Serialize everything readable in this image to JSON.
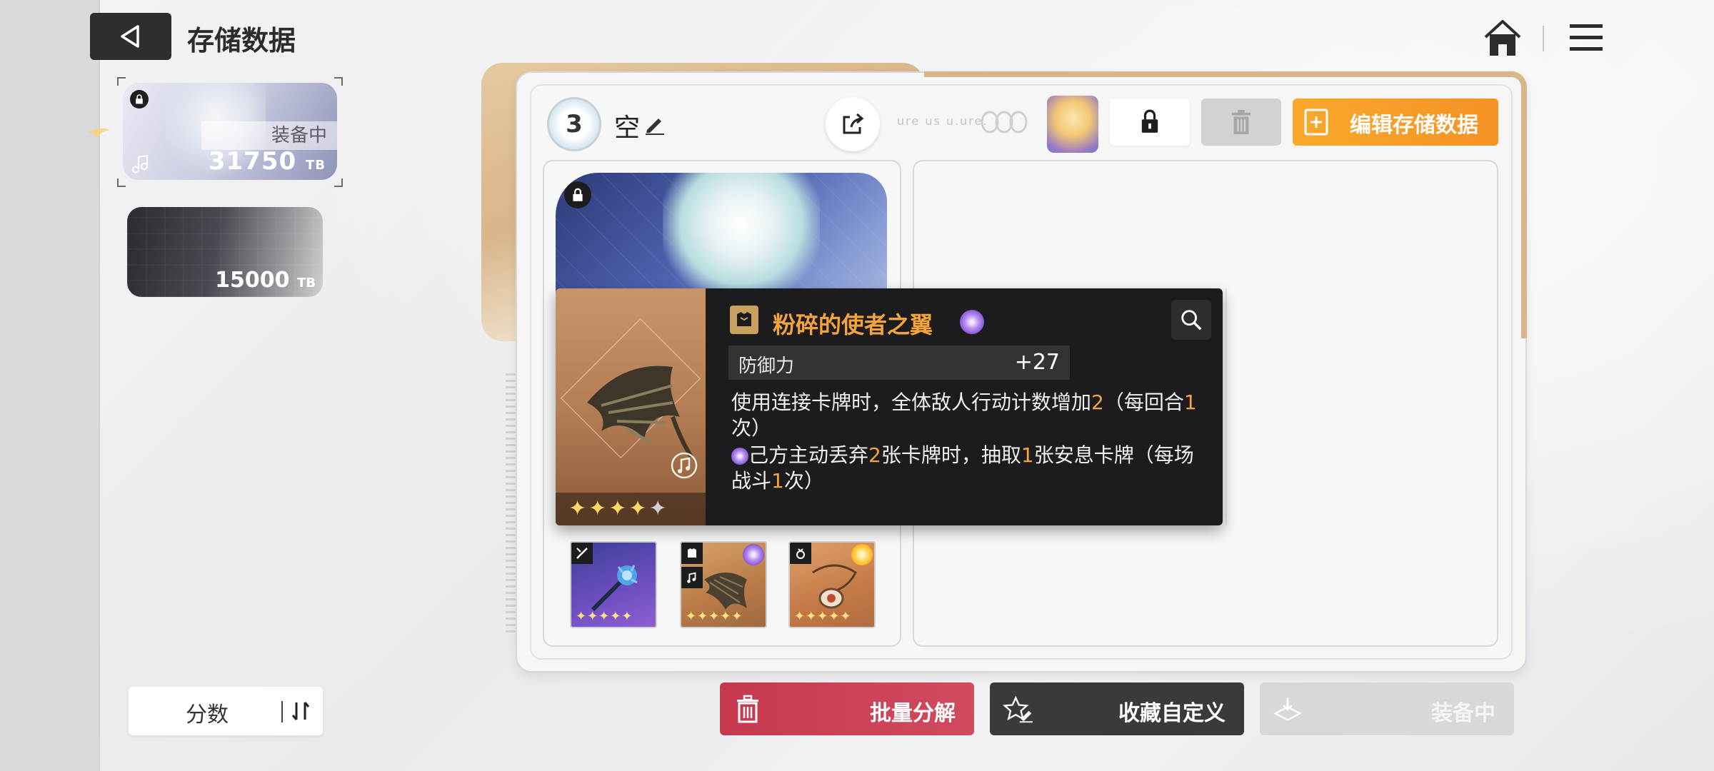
{
  "header": {
    "title": "存储数据"
  },
  "save_list": {
    "items": [
      {
        "status": "装备中",
        "score": "31750",
        "unit": "TB",
        "locked": true
      },
      {
        "status": "",
        "score": "15000",
        "unit": "TB",
        "locked": false
      }
    ]
  },
  "sort": {
    "label": "分数"
  },
  "panel": {
    "level": "3",
    "name": "空",
    "faded_code": "ure us u.ure."
  },
  "toolbar": {
    "edit_label": "编辑存储数据"
  },
  "tooltip": {
    "item_name": "粉碎的使者之翼",
    "stat_label": "防御力",
    "stat_value": "+27",
    "stars_filled": 4,
    "stars_total": 5,
    "effect1": {
      "p1": "使用连接卡牌时，全体敌人行动计数增加",
      "n1": "2",
      "p2": "（每回合",
      "n2": "1",
      "p3": "次）"
    },
    "effect2": {
      "p1": "己方主动丢弃",
      "n1": "2",
      "p2": "张卡牌时，抽取",
      "n2": "1",
      "p3": "张安息卡牌（每场战斗",
      "n3": "1",
      "p4": "次）"
    }
  },
  "equipment": [
    {
      "slot": "weapon",
      "stars": "✦✦✦✦✦"
    },
    {
      "slot": "armor",
      "stars": "✦✦✦✦✦"
    },
    {
      "slot": "accessory",
      "stars": "✦✦✦✦✦"
    }
  ],
  "actions": {
    "dismantle": "批量分解",
    "custom": "收藏自定义",
    "equip": "装备中"
  },
  "colors": {
    "accent_orange": "#f59223",
    "dismantle_red": "#c6394f",
    "tooltip_bg": "#1c1c1e",
    "highlight": "#f4a43a"
  }
}
